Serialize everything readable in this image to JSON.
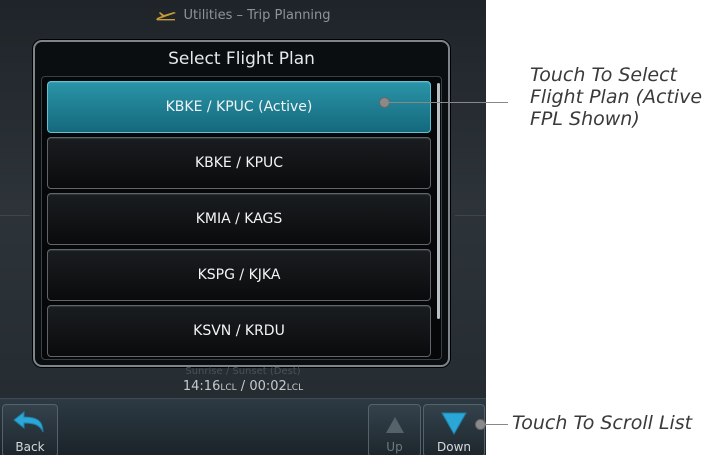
{
  "header": {
    "title": "Utilities – Trip Planning"
  },
  "popup": {
    "title": "Select Flight Plan",
    "items": [
      {
        "label": "KBKE / KPUC (Active)",
        "active": true
      },
      {
        "label": "KBKE / KPUC",
        "active": false
      },
      {
        "label": "KMIA / KAGS",
        "active": false
      },
      {
        "label": "KSPG / KJKA",
        "active": false
      },
      {
        "label": "KSVN / KRDU",
        "active": false
      }
    ]
  },
  "sunrise": {
    "label": "Sunrise / Sunset (Dest)",
    "rise": "14:16",
    "set": "00:02",
    "unit": "LCL",
    "separator": "/"
  },
  "buttons": {
    "back": "Back",
    "up": "Up",
    "down": "Down"
  },
  "callouts": {
    "select_plan": "Touch To Select Flight Plan (Active FPL Shown)",
    "scroll": "Touch To Scroll List"
  },
  "colors": {
    "active_row": "#1f8297",
    "scroll_arrow": "#2aa7d6"
  }
}
